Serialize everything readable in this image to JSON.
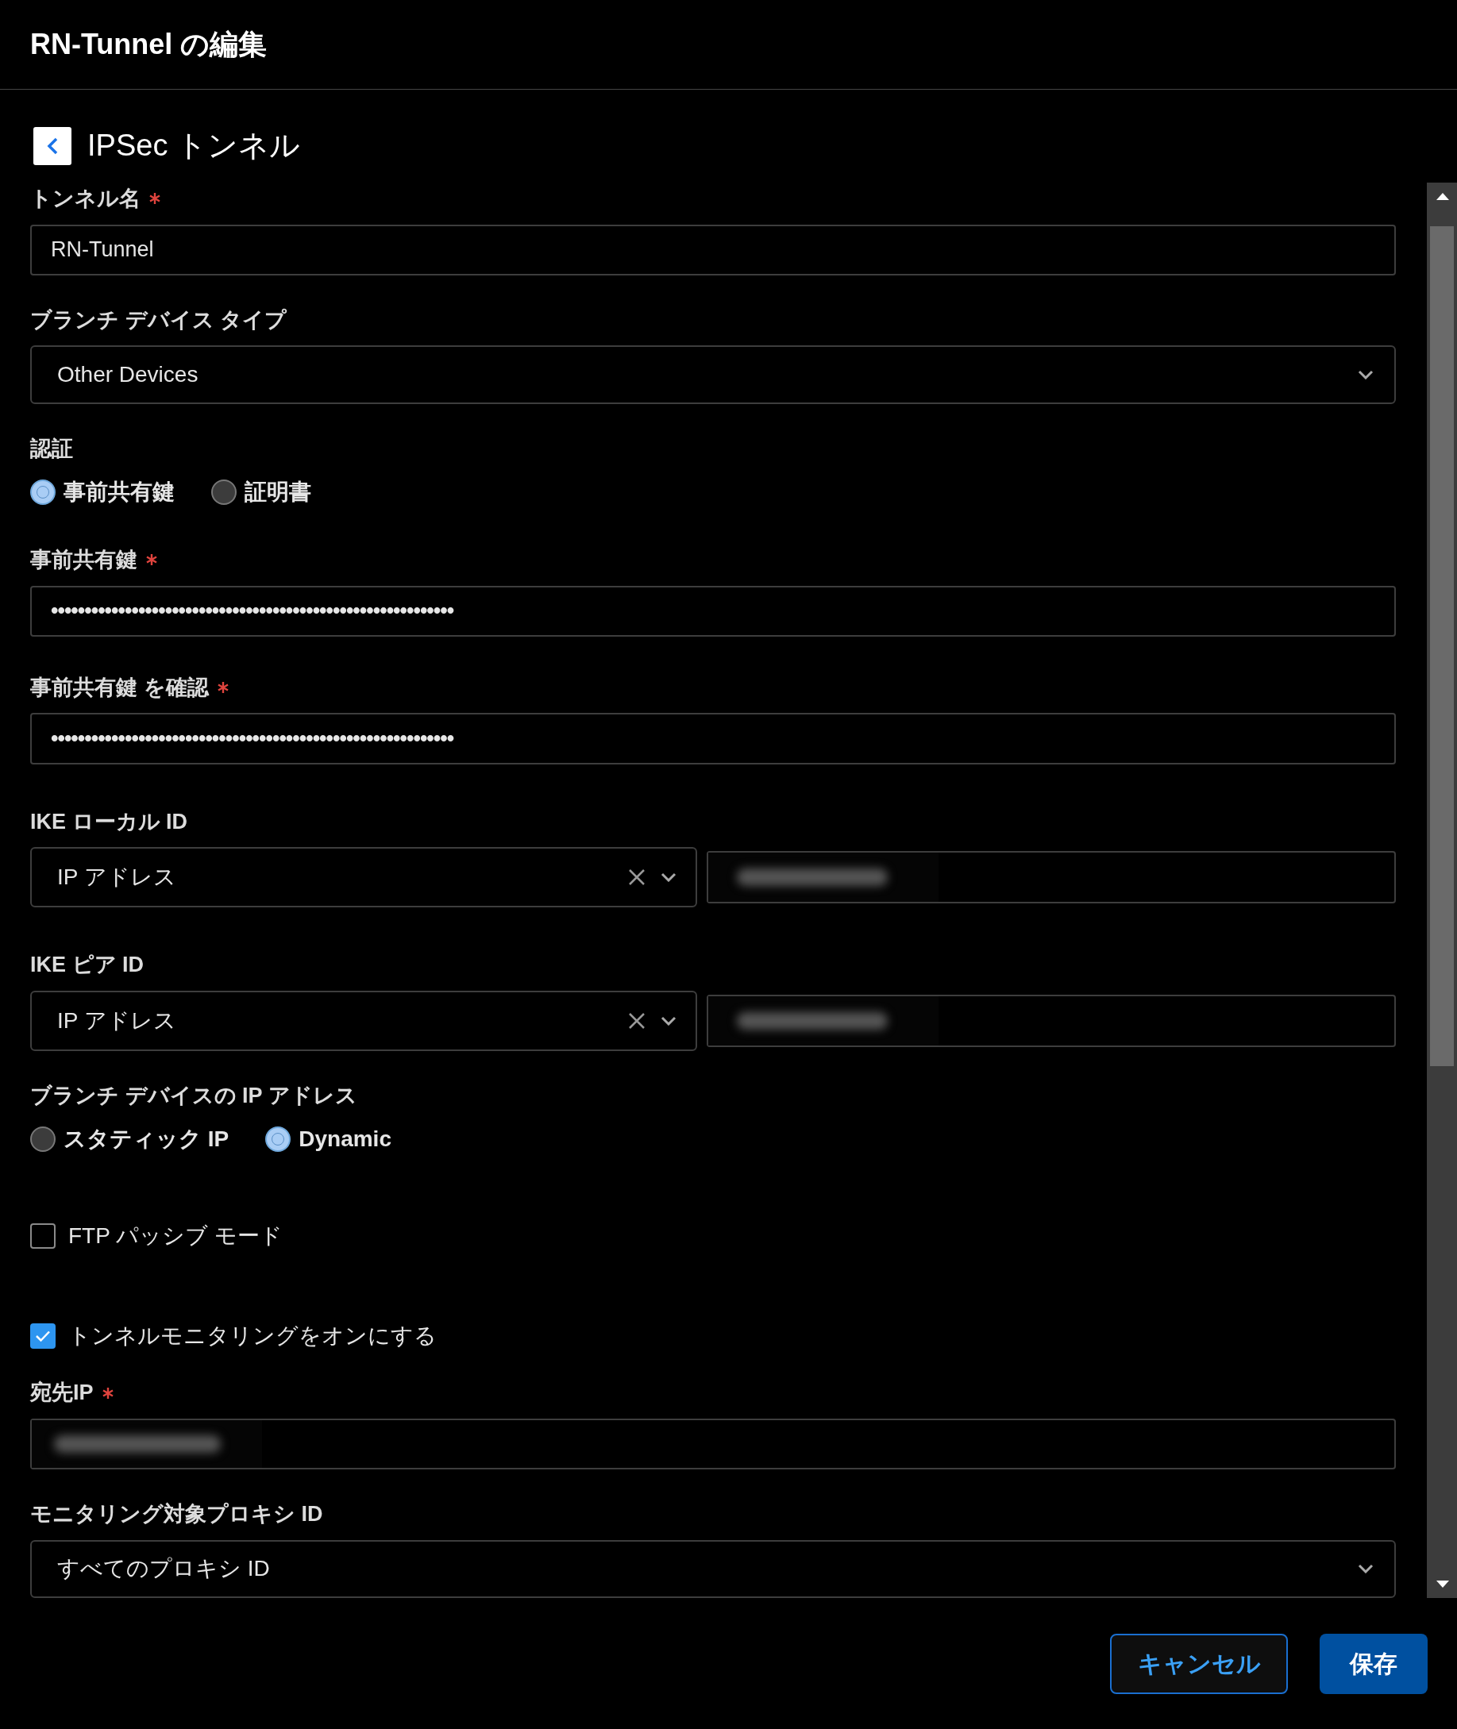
{
  "window": {
    "title": "RN-Tunnel の編集"
  },
  "section": {
    "title": "IPSec トンネル"
  },
  "fields": [
    {
      "kind": "text",
      "label": "トンネル名",
      "required": true,
      "value": "RN-Tunnel"
    },
    {
      "kind": "select",
      "label": "ブランチ デバイス タイプ",
      "required": false,
      "value": "Other Devices"
    },
    {
      "kind": "radio",
      "label": "認証",
      "options": [
        {
          "label": "事前共有鍵",
          "selected": true
        },
        {
          "label": "証明書",
          "selected": false
        }
      ]
    },
    {
      "kind": "password",
      "label": "事前共有鍵",
      "required": true,
      "value": "••••••••••••••••••••••••••••••••••••••••••••••••••••••••••••"
    },
    {
      "kind": "password",
      "label": "事前共有鍵 を確認",
      "required": true,
      "value": "••••••••••••••••••••••••••••••••••••••••••••••••••••••••••••"
    },
    {
      "kind": "id",
      "label": "IKE ローカル ID",
      "value": "IP アドレス"
    },
    {
      "kind": "id",
      "label": "IKE ピア ID",
      "value": "IP アドレス"
    },
    {
      "kind": "radio",
      "label": "ブランチ デバイスの IP アドレス",
      "options": [
        {
          "label": "スタティック IP",
          "selected": false
        },
        {
          "label": "Dynamic",
          "selected": true
        }
      ]
    },
    {
      "kind": "checkbox",
      "label": "FTP パッシブ モード",
      "checked": false
    },
    {
      "kind": "checkbox",
      "label": "トンネルモニタリングをオンにする",
      "checked": true
    },
    {
      "kind": "redacted",
      "label": "宛先IP",
      "required": true
    },
    {
      "kind": "select",
      "label": "モニタリング対象プロキシ ID",
      "required": false,
      "value": "すべてのプロキシ ID"
    }
  ],
  "buttons": [
    {
      "label": "キャンセル",
      "kind": "secondary"
    },
    {
      "label": "保存",
      "kind": "primary"
    }
  ]
}
